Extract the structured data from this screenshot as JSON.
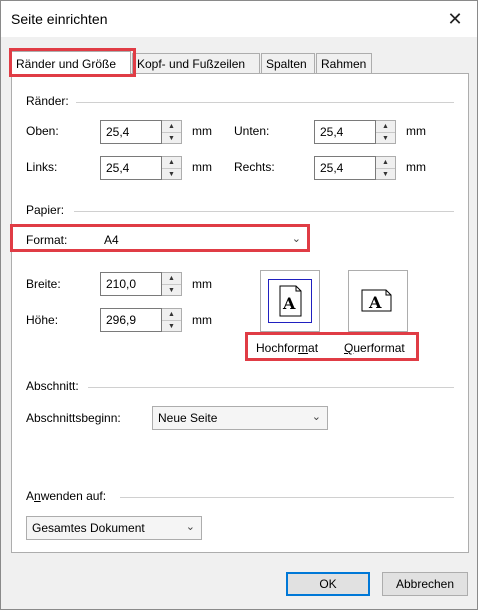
{
  "window": {
    "title": "Seite einrichten",
    "close": "✕"
  },
  "tabs": [
    {
      "label": "Ränder und Größe",
      "active": true
    },
    {
      "label": "Kopf- und Fußzeilen",
      "active": false
    },
    {
      "label": "Spalten",
      "active": false
    },
    {
      "label": "Rahmen",
      "active": false
    }
  ],
  "margins": {
    "group": "Ränder:",
    "top": {
      "label": "Oben:",
      "value": "25,4",
      "unit": "mm"
    },
    "bottom": {
      "label": "Unten:",
      "value": "25,4",
      "unit": "mm"
    },
    "left": {
      "label": "Links:",
      "value": "25,4",
      "unit": "mm"
    },
    "right": {
      "label": "Rechts:",
      "value": "25,4",
      "unit": "mm"
    }
  },
  "paper": {
    "group": "Papier:",
    "format_label": "Format:",
    "format_value": "A4",
    "width": {
      "label": "Breite:",
      "value": "210,0",
      "unit": "mm"
    },
    "height": {
      "label": "Höhe:",
      "value": "296,9",
      "unit": "mm"
    },
    "portrait": {
      "pre": "Hochfor",
      "accel": "m",
      "post": "at",
      "glyph": "A"
    },
    "landscape": {
      "pre": "",
      "accel": "Q",
      "post": "uerformat",
      "glyph": "A"
    }
  },
  "section": {
    "group": "Abschnitt:",
    "start_label": "Abschnittsbeginn:",
    "start_value": "Neue Seite"
  },
  "apply": {
    "pre": "A",
    "accel": "n",
    "post": "wenden auf:",
    "value": "Gesamtes Dokument"
  },
  "buttons": {
    "ok": "OK",
    "cancel": "Abbrechen"
  },
  "colors": {
    "highlight": "#e03c45",
    "accent": "#0078d7",
    "selection": "#2020c0"
  }
}
